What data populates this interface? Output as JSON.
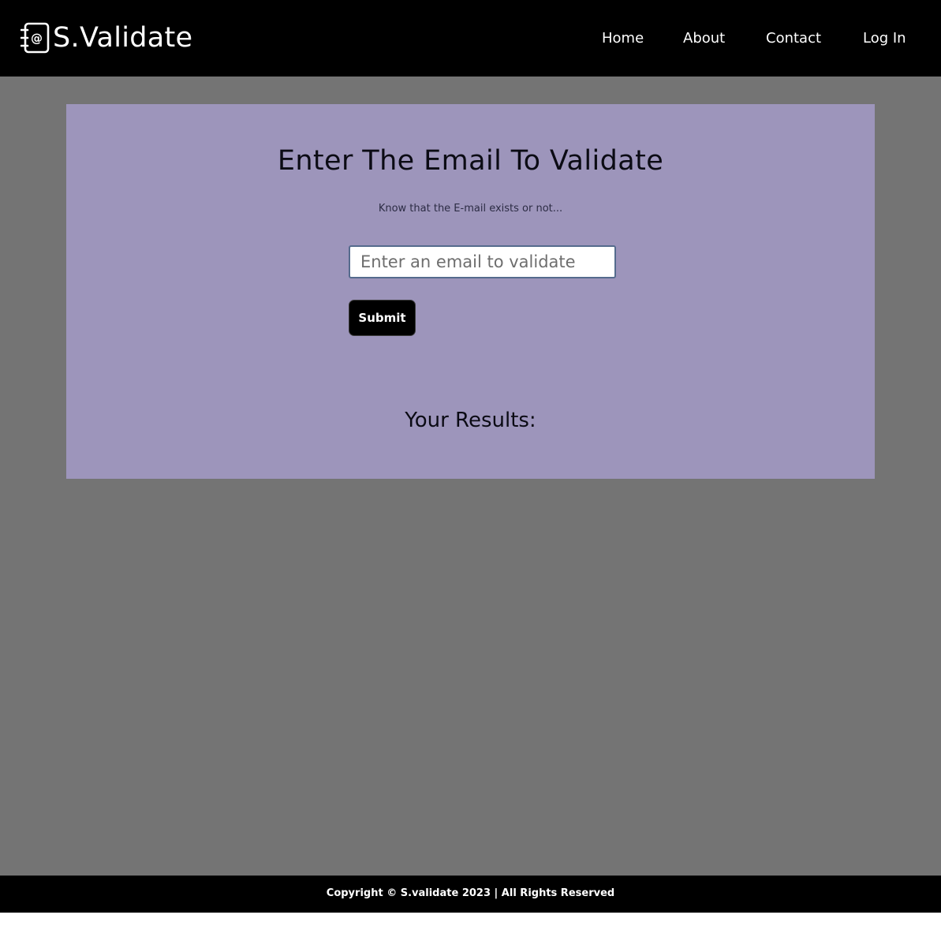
{
  "brand": {
    "name": "S.Validate",
    "icon": "email-book-icon"
  },
  "nav": {
    "items": [
      {
        "label": "Home"
      },
      {
        "label": "About"
      },
      {
        "label": "Contact"
      },
      {
        "label": "Log In"
      }
    ]
  },
  "main": {
    "title": "Enter The Email To Validate",
    "subtitle": "Know that the E-mail exists or not...",
    "email_input": {
      "placeholder": "Enter an email to validate",
      "value": ""
    },
    "submit_label": "Submit",
    "results_title": "Your Results:"
  },
  "footer": {
    "copyright": "Copyright © S.validate 2023 | All Rights Reserved"
  },
  "colors": {
    "navbar": "#000000",
    "page_background": "#747474",
    "card_background": "#9d95bb",
    "footer": "#000000"
  }
}
